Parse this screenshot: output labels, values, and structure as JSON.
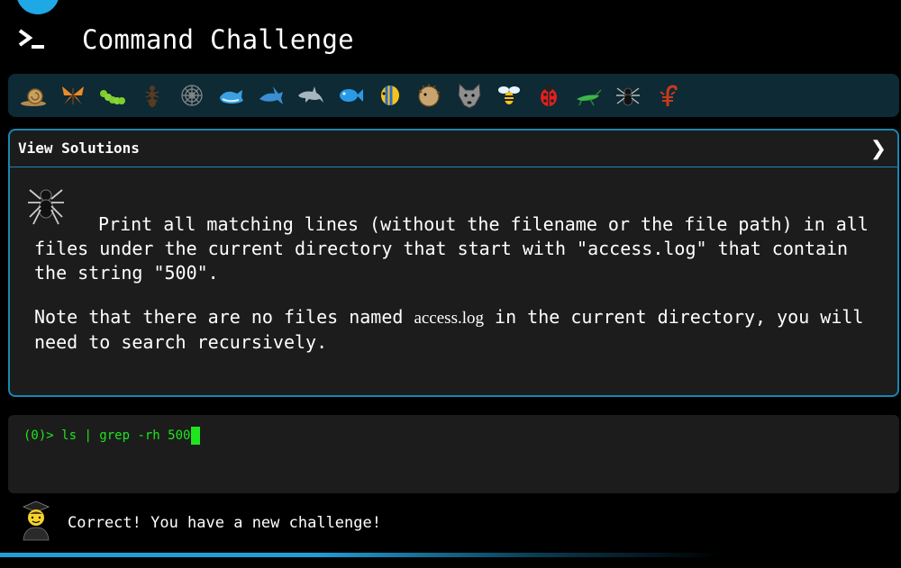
{
  "header": {
    "title": "Command Challenge"
  },
  "creatures": [
    {
      "name": "snail-icon"
    },
    {
      "name": "butterfly-icon"
    },
    {
      "name": "caterpillar-icon"
    },
    {
      "name": "ant-icon"
    },
    {
      "name": "spider-web-icon"
    },
    {
      "name": "whale-icon"
    },
    {
      "name": "shark-icon"
    },
    {
      "name": "dolphin-icon"
    },
    {
      "name": "fish-icon"
    },
    {
      "name": "tropical-fish-icon"
    },
    {
      "name": "blowfish-icon"
    },
    {
      "name": "wolf-icon"
    },
    {
      "name": "bee-icon"
    },
    {
      "name": "ladybug-icon"
    },
    {
      "name": "cricket-icon"
    },
    {
      "name": "spider-icon"
    },
    {
      "name": "scorpion-icon"
    }
  ],
  "panel": {
    "header_label": "View Solutions",
    "desc_line1": "Print all matching lines (without the filename or the file path) in all files under the current directory that start with \"access.log\" that contain the string \"500\".",
    "note_before": "Note that there are no files named ",
    "note_code": "access.log",
    "note_after": " in the current directory, you will need to search recursively."
  },
  "terminal": {
    "prompt": "(0)> ",
    "command": "ls | grep -rh 500"
  },
  "status": {
    "message": "Correct! You have a new challenge!"
  },
  "colors": {
    "accent": "#1787b3",
    "terminal_text": "#1ee61e",
    "icon_bar": "#0d2a35"
  }
}
